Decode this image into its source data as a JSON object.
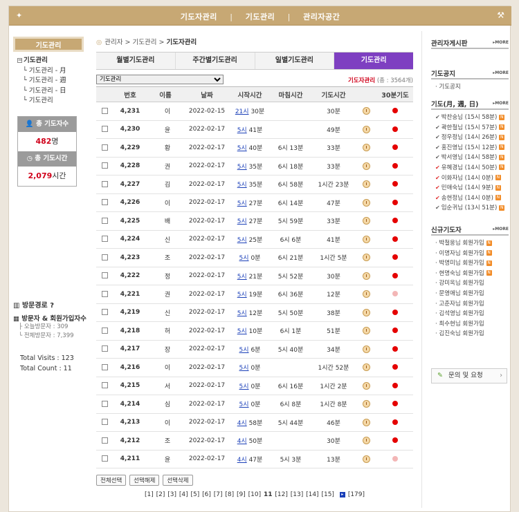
{
  "topnav": {
    "items": [
      "기도자관리",
      "기도관리",
      "관리자공간"
    ],
    "sep": "|"
  },
  "left": {
    "title": "기도관리",
    "tree_root": "기도관리",
    "tree_children": [
      "기도관리 - 月",
      "기도관리 - 週",
      "기도관리 - 日",
      "기도관리"
    ],
    "stat1_label": "총 기도자수",
    "stat1_value": "482",
    "stat1_unit": "명",
    "stat2_label": "총 기도시간",
    "stat2_value": "2,079",
    "stat2_unit": "시간",
    "visit_title": "방문경로",
    "visit_sub_title": "방문자 & 회원가입자수",
    "today_visitors": "오늘방문자 : 309",
    "total_visitors": "전체방문자 : 7,399",
    "total_visits": "Total Visits : 123",
    "total_count": "Total Count : 11"
  },
  "main": {
    "crumb": [
      "관리자",
      "기도관리",
      "기도자관리"
    ],
    "tabs": [
      "월별기도관리",
      "주간별기도관리",
      "일별기도관리",
      "기도관리"
    ],
    "select_value": "기도관리",
    "count_label": "기도자관리",
    "count_text": "(총 : 3564개)",
    "headers": [
      "번호",
      "이름",
      "날짜",
      "시작시간",
      "마침시간",
      "기도시간",
      "30분기도"
    ],
    "rows": [
      {
        "no": "4,231",
        "name": "이",
        "date": "2022-02-15",
        "start_h": "21시",
        "start_m": "30분",
        "end": "",
        "dur": "30분",
        "dot": "red"
      },
      {
        "no": "4,230",
        "name": "윤",
        "date": "2022-02-17",
        "start_h": "5시",
        "start_m": "41분",
        "end": "",
        "dur": "49분",
        "dot": "red"
      },
      {
        "no": "4,229",
        "name": "황",
        "date": "2022-02-17",
        "start_h": "5시",
        "start_m": "40분",
        "end": "6시 13분",
        "dur": "33분",
        "dot": "red"
      },
      {
        "no": "4,228",
        "name": "권",
        "date": "2022-02-17",
        "start_h": "5시",
        "start_m": "35분",
        "end": "6시 18분",
        "dur": "33분",
        "dot": "red"
      },
      {
        "no": "4,227",
        "name": "김",
        "date": "2022-02-17",
        "start_h": "5시",
        "start_m": "35분",
        "end": "6시 58분",
        "dur": "1시간 23분",
        "dot": "red"
      },
      {
        "no": "4,226",
        "name": "이",
        "date": "2022-02-17",
        "start_h": "5시",
        "start_m": "27분",
        "end": "6시 14분",
        "dur": "47분",
        "dot": "red"
      },
      {
        "no": "4,225",
        "name": "배",
        "date": "2022-02-17",
        "start_h": "5시",
        "start_m": "27분",
        "end": "5시 59분",
        "dur": "33분",
        "dot": "red"
      },
      {
        "no": "4,224",
        "name": "신",
        "date": "2022-02-17",
        "start_h": "5시",
        "start_m": "25분",
        "end": "6시 6분",
        "dur": "41분",
        "dot": "red"
      },
      {
        "no": "4,223",
        "name": "조",
        "date": "2022-02-17",
        "start_h": "5시",
        "start_m": "0분",
        "end": "6시 21분",
        "dur": "1시간 5분",
        "dot": "red"
      },
      {
        "no": "4,222",
        "name": "정",
        "date": "2022-02-17",
        "start_h": "5시",
        "start_m": "21분",
        "end": "5시 52분",
        "dur": "30분",
        "dot": "red"
      },
      {
        "no": "4,221",
        "name": "권",
        "date": "2022-02-17",
        "start_h": "5시",
        "start_m": "19분",
        "end": "6시 36분",
        "dur": "12분",
        "dot": "pink"
      },
      {
        "no": "4,219",
        "name": "신",
        "date": "2022-02-17",
        "start_h": "5시",
        "start_m": "12분",
        "end": "5시 50분",
        "dur": "38분",
        "dot": "red"
      },
      {
        "no": "4,218",
        "name": "허",
        "date": "2022-02-17",
        "start_h": "5시",
        "start_m": "10분",
        "end": "6시 1분",
        "dur": "51분",
        "dot": "red"
      },
      {
        "no": "4,217",
        "name": "장",
        "date": "2022-02-17",
        "start_h": "5시",
        "start_m": "6분",
        "end": "5시 40분",
        "dur": "34분",
        "dot": "red"
      },
      {
        "no": "4,216",
        "name": "이",
        "date": "2022-02-17",
        "start_h": "5시",
        "start_m": "0분",
        "end": "",
        "dur": "1시간 52분",
        "dot": "red"
      },
      {
        "no": "4,215",
        "name": "서",
        "date": "2022-02-17",
        "start_h": "5시",
        "start_m": "0분",
        "end": "6시 16분",
        "dur": "1시간 2분",
        "dot": "red"
      },
      {
        "no": "4,214",
        "name": "심",
        "date": "2022-02-17",
        "start_h": "5시",
        "start_m": "0분",
        "end": "6시 8분",
        "dur": "1시간 8분",
        "dot": "red"
      },
      {
        "no": "4,213",
        "name": "이",
        "date": "2022-02-17",
        "start_h": "4시",
        "start_m": "58분",
        "end": "5시 44분",
        "dur": "46분",
        "dot": "red"
      },
      {
        "no": "4,212",
        "name": "조",
        "date": "2022-02-17",
        "start_h": "4시",
        "start_m": "50분",
        "end": "",
        "dur": "30분",
        "dot": "red"
      },
      {
        "no": "4,211",
        "name": "윤",
        "date": "2022-02-17",
        "start_h": "4시",
        "start_m": "47분",
        "end": "5시 3분",
        "dur": "13분",
        "dot": "pink"
      }
    ],
    "buttons": [
      "전체선택",
      "선택해제",
      "선택삭제"
    ],
    "pages": [
      "[1]",
      "[2]",
      "[3]",
      "[4]",
      "[5]",
      "[6]",
      "[7]",
      "[8]",
      "[9]",
      "[10]",
      "11",
      "[12]",
      "[13]",
      "[14]",
      "[15]"
    ],
    "current_page": "11",
    "last_page": "[179]"
  },
  "right": {
    "sec1_title": "관리자게시판",
    "sec2_title": "기도공지",
    "sec2_items": [
      "기도공지"
    ],
    "sec3_title": "기도(月, 週, 日)",
    "sec3_items": [
      {
        "text": "박찬숭님 (15시 58분)",
        "red": false
      },
      {
        "text": "곽한철님 (15시 57분)",
        "red": false
      },
      {
        "text": "정우정님 (14시 26분)",
        "red": false
      },
      {
        "text": "홍진영님 (15시 12분)",
        "red": false
      },
      {
        "text": "박서영님 (14시 58분)",
        "red": false
      },
      {
        "text": "유혜경님 (14시 50분)",
        "red": true
      },
      {
        "text": "이화자님 (14시 0분)",
        "red": true
      },
      {
        "text": "민애숙님 (14시 9분)",
        "red": true
      },
      {
        "text": "송현정님 (14시 0분)",
        "red": true
      },
      {
        "text": "임순귀님 (13시 51분)",
        "red": false
      }
    ],
    "sec4_title": "신규기도자",
    "sec4_items": [
      "박철웅님 회원가입",
      "이명자님 회원가입",
      "박명미님 회원가입",
      "현명숙님 회원가입",
      "강미옥님 회원가입",
      "문영애님 회원가입",
      "고춘자님 회원가입",
      "김석영님 회원가입",
      "최수현님 회원가입",
      "김진숙님 회원가입"
    ],
    "more": "MORE",
    "qa_label": "문의 및 요청"
  }
}
